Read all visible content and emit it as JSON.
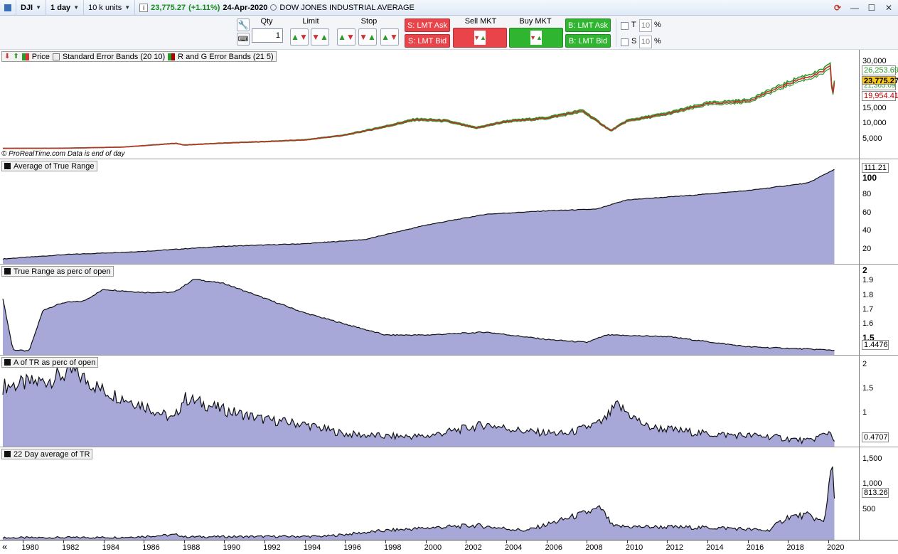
{
  "header": {
    "symbol": "DJI",
    "timeframe": "1 day",
    "units": "10 k units",
    "info_icon": "info-icon",
    "price": "23,775.27",
    "change": "(+1.11%)",
    "date": "24-Apr-2020",
    "instrument": "DOW JONES INDUSTRIAL AVERAGE"
  },
  "toolbar": {
    "qty_label": "Qty",
    "qty_value": "1",
    "limit_label": "Limit",
    "stop_label": "Stop",
    "s_lmt_ask": "S: LMT Ask",
    "s_lmt_bid": "S: LMT Bid",
    "sell_mkt": "Sell MKT",
    "buy_mkt": "Buy MKT",
    "b_lmt_ask": "B: LMT Ask",
    "b_lmt_bid": "B: LMT Bid",
    "t_label": "T",
    "s_label": "S",
    "t_value": "10",
    "s_value": "10",
    "pct": "%"
  },
  "price_panel": {
    "legend_price": "Price",
    "legend_seb": "Standard Error Bands (20 10)",
    "legend_rg": "R and G Error Bands (21 5)",
    "watermark": "© ProRealTime.com",
    "watermark_note": "Data is end of day",
    "ticks": [
      "30,000",
      "15,000",
      "10,000",
      "5,000"
    ],
    "val_upper": "26,253.69",
    "val_price": "23,775.27",
    "val_mid": "21,365.09",
    "val_lower": "19,954.41"
  },
  "atr_panel": {
    "title": "Average of True Range",
    "ticks": [
      "100",
      "80",
      "60",
      "40",
      "20"
    ],
    "value": "111.21"
  },
  "trp_panel": {
    "title": "True Range as perc of open",
    "ticks": [
      "2",
      "1.9",
      "1.8",
      "1.7",
      "1.6",
      "1.5"
    ],
    "value": "1.4476"
  },
  "atrp_panel": {
    "title": "A of TR as perc of open",
    "ticks": [
      "2",
      "1.5",
      "1",
      "0.5"
    ],
    "value": "0.4707"
  },
  "avg22_panel": {
    "title": "22 Day average of TR",
    "ticks": [
      "1,500",
      "1,000",
      "500"
    ],
    "value": "813.26"
  },
  "x_axis": {
    "labels": [
      "1980",
      "1982",
      "1984",
      "1986",
      "1988",
      "1990",
      "1992",
      "1994",
      "1996",
      "1998",
      "2000",
      "2002",
      "2004",
      "2006",
      "2008",
      "2010",
      "2012",
      "2014",
      "2016",
      "2018",
      "2020"
    ],
    "scroll_icon": "«"
  },
  "chart_data": [
    {
      "type": "line",
      "title": "DOW JONES INDUSTRIAL AVERAGE",
      "x": [
        1979,
        1982,
        1985,
        1987.6,
        1988,
        1990,
        1992,
        1994,
        1996,
        1998,
        1999.5,
        2001,
        2002.5,
        2004,
        2006,
        2007.8,
        2009.2,
        2010,
        2012,
        2014,
        2016,
        2017.5,
        2018.5,
        2019.5,
        2020.1,
        2020.2,
        2020.3
      ],
      "series": [
        {
          "name": "Price",
          "values": [
            850,
            900,
            1300,
            2600,
            2000,
            2700,
            3200,
            3800,
            5500,
            8500,
            11000,
            10500,
            8000,
            10300,
            11500,
            14000,
            7000,
            10500,
            13000,
            16500,
            17500,
            22000,
            25000,
            27000,
            29500,
            19000,
            23775
          ]
        }
      ],
      "ylim": [
        0,
        32000
      ]
    },
    {
      "type": "area",
      "title": "Average of True Range",
      "x": [
        1979,
        1982,
        1986,
        1990,
        1994,
        1997,
        2000,
        2003,
        2006,
        2008.5,
        2010,
        2013,
        2016,
        2019,
        2020.3
      ],
      "series": [
        {
          "name": "Average of True Range",
          "values": [
            5,
            10,
            14,
            20,
            23,
            28,
            45,
            58,
            62,
            64,
            75,
            80,
            86,
            95,
            111.21
          ]
        }
      ],
      "ylim": [
        0,
        118
      ]
    },
    {
      "type": "area",
      "title": "True Range as perc of open",
      "x": [
        1979,
        1979.5,
        1980.3,
        1981,
        1982,
        1983,
        1984,
        1986,
        1987.5,
        1988.5,
        1990,
        1994,
        1998,
        2000,
        2003,
        2006,
        2008,
        2009,
        2012,
        2016,
        2020.3
      ],
      "series": [
        {
          "name": "True Range as perc of open",
          "values": [
            1.8,
            1.45,
            1.44,
            1.72,
            1.77,
            1.78,
            1.86,
            1.84,
            1.84,
            1.93,
            1.9,
            1.7,
            1.55,
            1.55,
            1.57,
            1.52,
            1.5,
            1.55,
            1.54,
            1.47,
            1.4476
          ]
        }
      ],
      "ylim": [
        1.42,
        2.0
      ]
    },
    {
      "type": "area",
      "title": "A of TR as perc of open",
      "x": [
        1979,
        1981,
        1982.5,
        1984,
        1986,
        1987.5,
        1988,
        1990,
        1992,
        1994,
        1996,
        1998,
        2000,
        2003,
        2005,
        2007,
        2008.8,
        2009.5,
        2011,
        2014,
        2017,
        2019,
        2020.1,
        2020.3
      ],
      "series": [
        {
          "name": "A of TR as perc of open",
          "values": [
            1.6,
            1.7,
            1.9,
            1.5,
            1.2,
            0.9,
            1.35,
            1.1,
            0.9,
            0.8,
            0.6,
            0.55,
            0.55,
            0.8,
            0.65,
            0.6,
            0.85,
            1.2,
            0.75,
            0.6,
            0.55,
            0.45,
            0.65,
            0.4707
          ]
        }
      ],
      "ylim": [
        0.35,
        2.15
      ]
    },
    {
      "type": "area",
      "title": "22 Day average of TR",
      "x": [
        1979,
        1985,
        1987.7,
        1988,
        1995,
        1998,
        2000,
        2002.5,
        2005,
        2008.7,
        2009.3,
        2012,
        2015,
        2017,
        2018,
        2019,
        2019.8,
        2020.2,
        2020.3
      ],
      "series": [
        {
          "name": "22 Day average of TR",
          "values": [
            10,
            20,
            70,
            30,
            40,
            150,
            200,
            250,
            150,
            580,
            230,
            220,
            200,
            150,
            420,
            450,
            300,
            1600,
            813.26
          ]
        }
      ],
      "ylim": [
        0,
        1680
      ]
    }
  ]
}
